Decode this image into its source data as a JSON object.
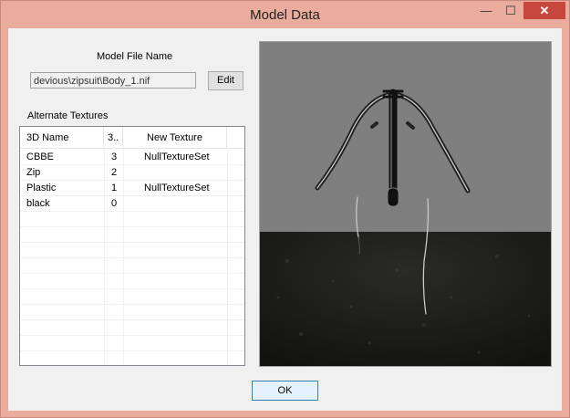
{
  "window": {
    "title": "Model Data",
    "minimize": "—",
    "maximize": "☐",
    "close": "✕"
  },
  "model_file": {
    "label": "Model File Name",
    "value": "devious\\zipsuit\\Body_1.nif",
    "edit_label": "Edit"
  },
  "alt_textures": {
    "label": "Alternate Textures",
    "columns": [
      "3D Name",
      "3..",
      "New Texture"
    ],
    "rows": [
      {
        "name": "CBBE",
        "index": "3",
        "texture": "NullTextureSet"
      },
      {
        "name": "Zip",
        "index": "2",
        "texture": ""
      },
      {
        "name": "Plastic",
        "index": "1",
        "texture": "NullTextureSet"
      },
      {
        "name": "black",
        "index": "0",
        "texture": ""
      }
    ]
  },
  "ok_label": "OK"
}
